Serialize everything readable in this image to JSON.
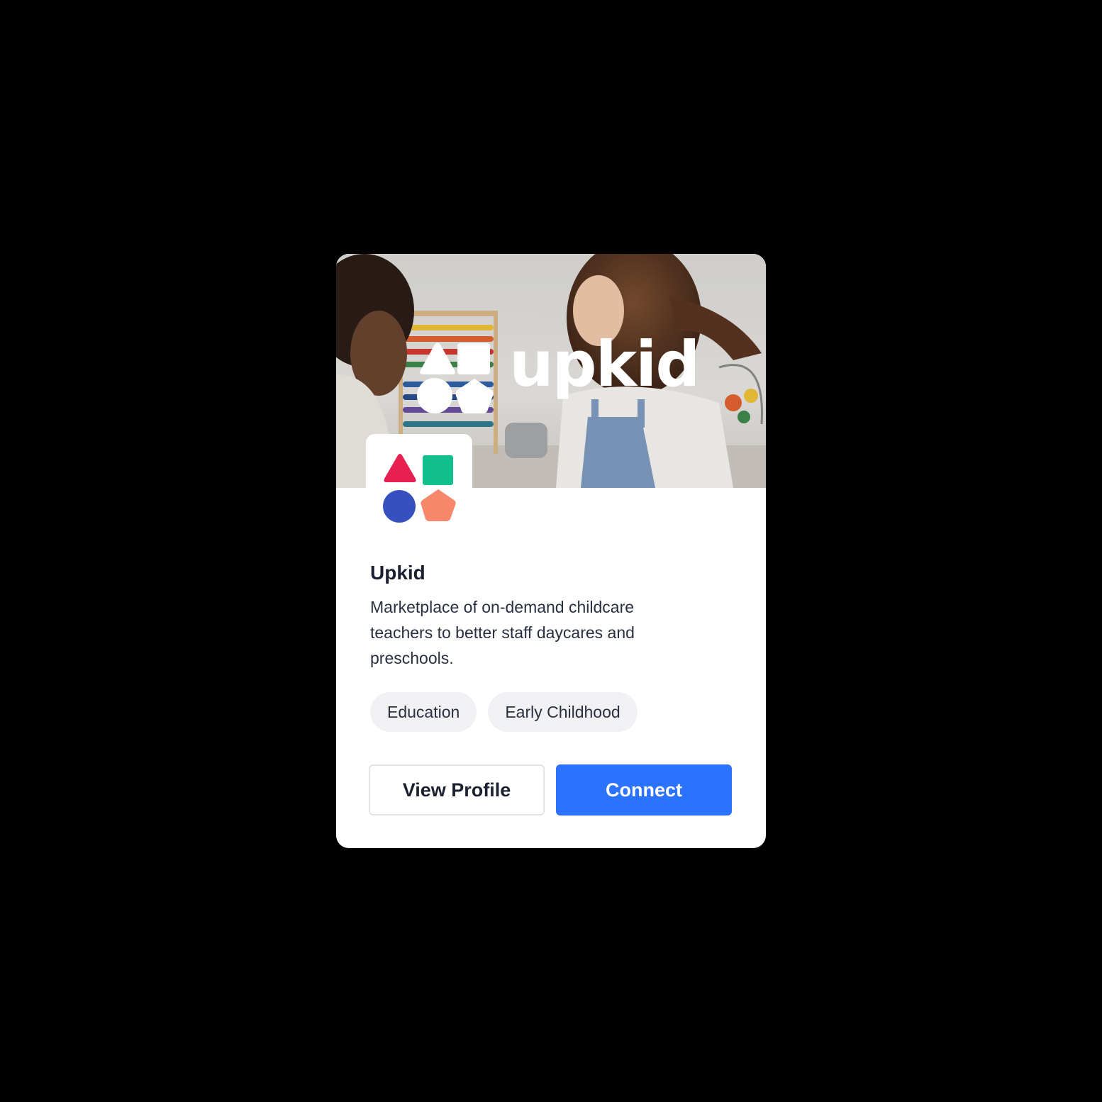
{
  "card": {
    "banner": {
      "logo_text": "upkid"
    },
    "company_name": "Upkid",
    "description": "Marketplace of on-demand childcare teachers to better staff daycares and preschools.",
    "tags": [
      "Education",
      "Early Childhood"
    ],
    "buttons": {
      "view_profile": "View Profile",
      "connect": "Connect"
    }
  },
  "colors": {
    "page_background": "#000000",
    "card_background": "#ffffff",
    "primary": "#2a72ff",
    "logo_triangle": "#e8204f",
    "logo_square": "#12c08e",
    "logo_circle": "#3650c0",
    "logo_pentagon": "#f6876b",
    "tag_background": "#f1f1f3"
  },
  "icons": {
    "banner_logo": "upkid-shapes-logo-white",
    "avatar_logo": "upkid-shapes-logo-color"
  }
}
